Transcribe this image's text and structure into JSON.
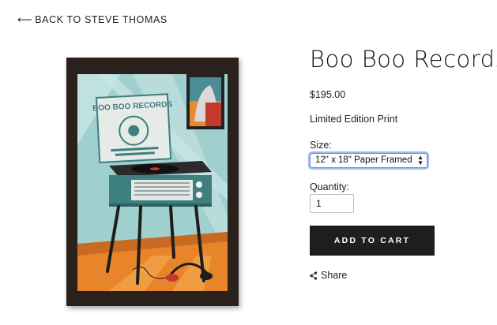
{
  "nav": {
    "back_label": "BACK TO STEVE THOMAS",
    "back_icon": "left-arrow-icon"
  },
  "product": {
    "title": "Boo Boo Records",
    "price": "$195.00",
    "description": "Limited Edition Print",
    "size_label": "Size:",
    "size_selected": "12\" x 18\" Paper Framed",
    "quantity_label": "Quantity:",
    "quantity_value": "1",
    "add_to_cart_label": "ADD TO CART",
    "share_label": "Share"
  },
  "artwork": {
    "crate_text": "BOO BOO RECORDS",
    "frame_color": "#2a211d",
    "wall_color": "#9fd0cf",
    "floor_color": "#e8842a",
    "turntable_color": "#3e7f80"
  }
}
